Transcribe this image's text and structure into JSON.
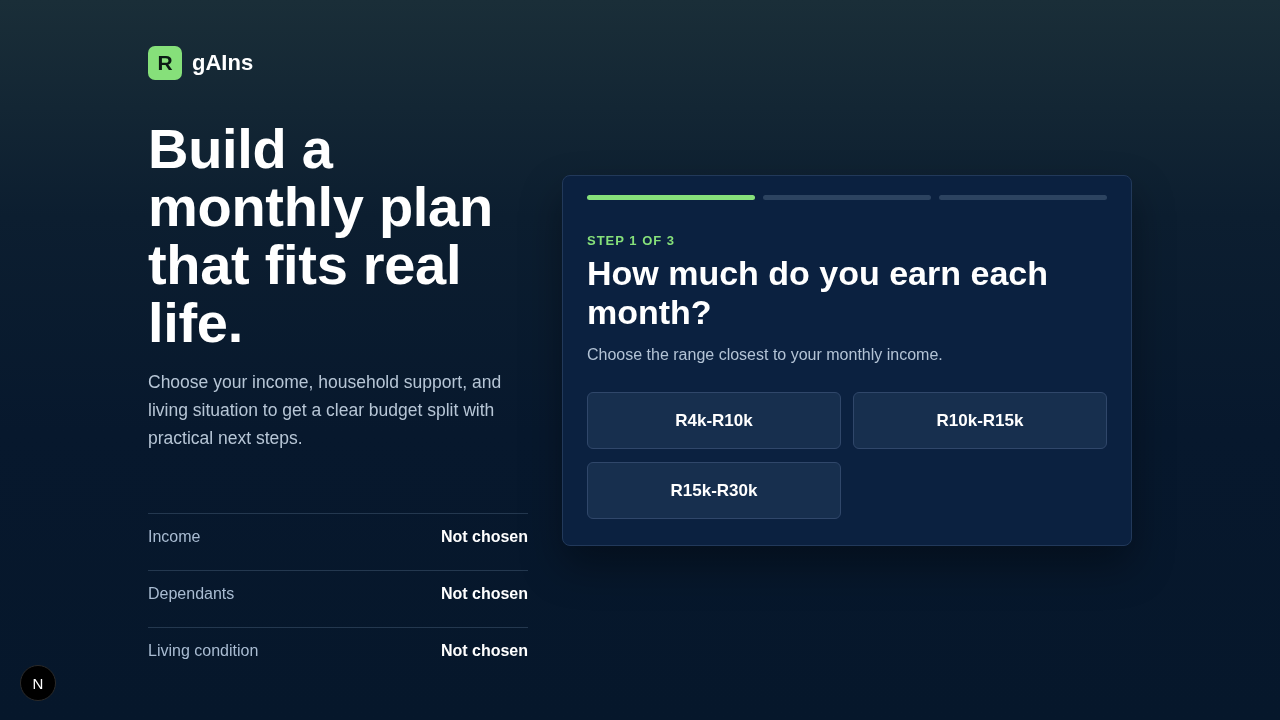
{
  "brand": {
    "mark": "R",
    "name": "gAIns"
  },
  "hero": {
    "title": "Build a monthly plan that fits real life.",
    "description": "Choose your income, household support, and living situation to get a clear budget split with practical next steps."
  },
  "summary": [
    {
      "label": "Income",
      "value": "Not chosen"
    },
    {
      "label": "Dependants",
      "value": "Not chosen"
    },
    {
      "label": "Living condition",
      "value": "Not chosen"
    }
  ],
  "wizard": {
    "steps": [
      {
        "done": true
      },
      {
        "done": false
      },
      {
        "done": false
      }
    ],
    "step_label": "STEP 1 OF 3",
    "question": "How much do you earn each month?",
    "hint": "Choose the range closest to your monthly income.",
    "options": [
      {
        "label": "R4k-R10k",
        "selected": false
      },
      {
        "label": "R10k-R15k",
        "selected": false
      },
      {
        "label": "R15k-R30k",
        "selected": false
      }
    ]
  },
  "dev_indicator": {
    "label": "N"
  }
}
